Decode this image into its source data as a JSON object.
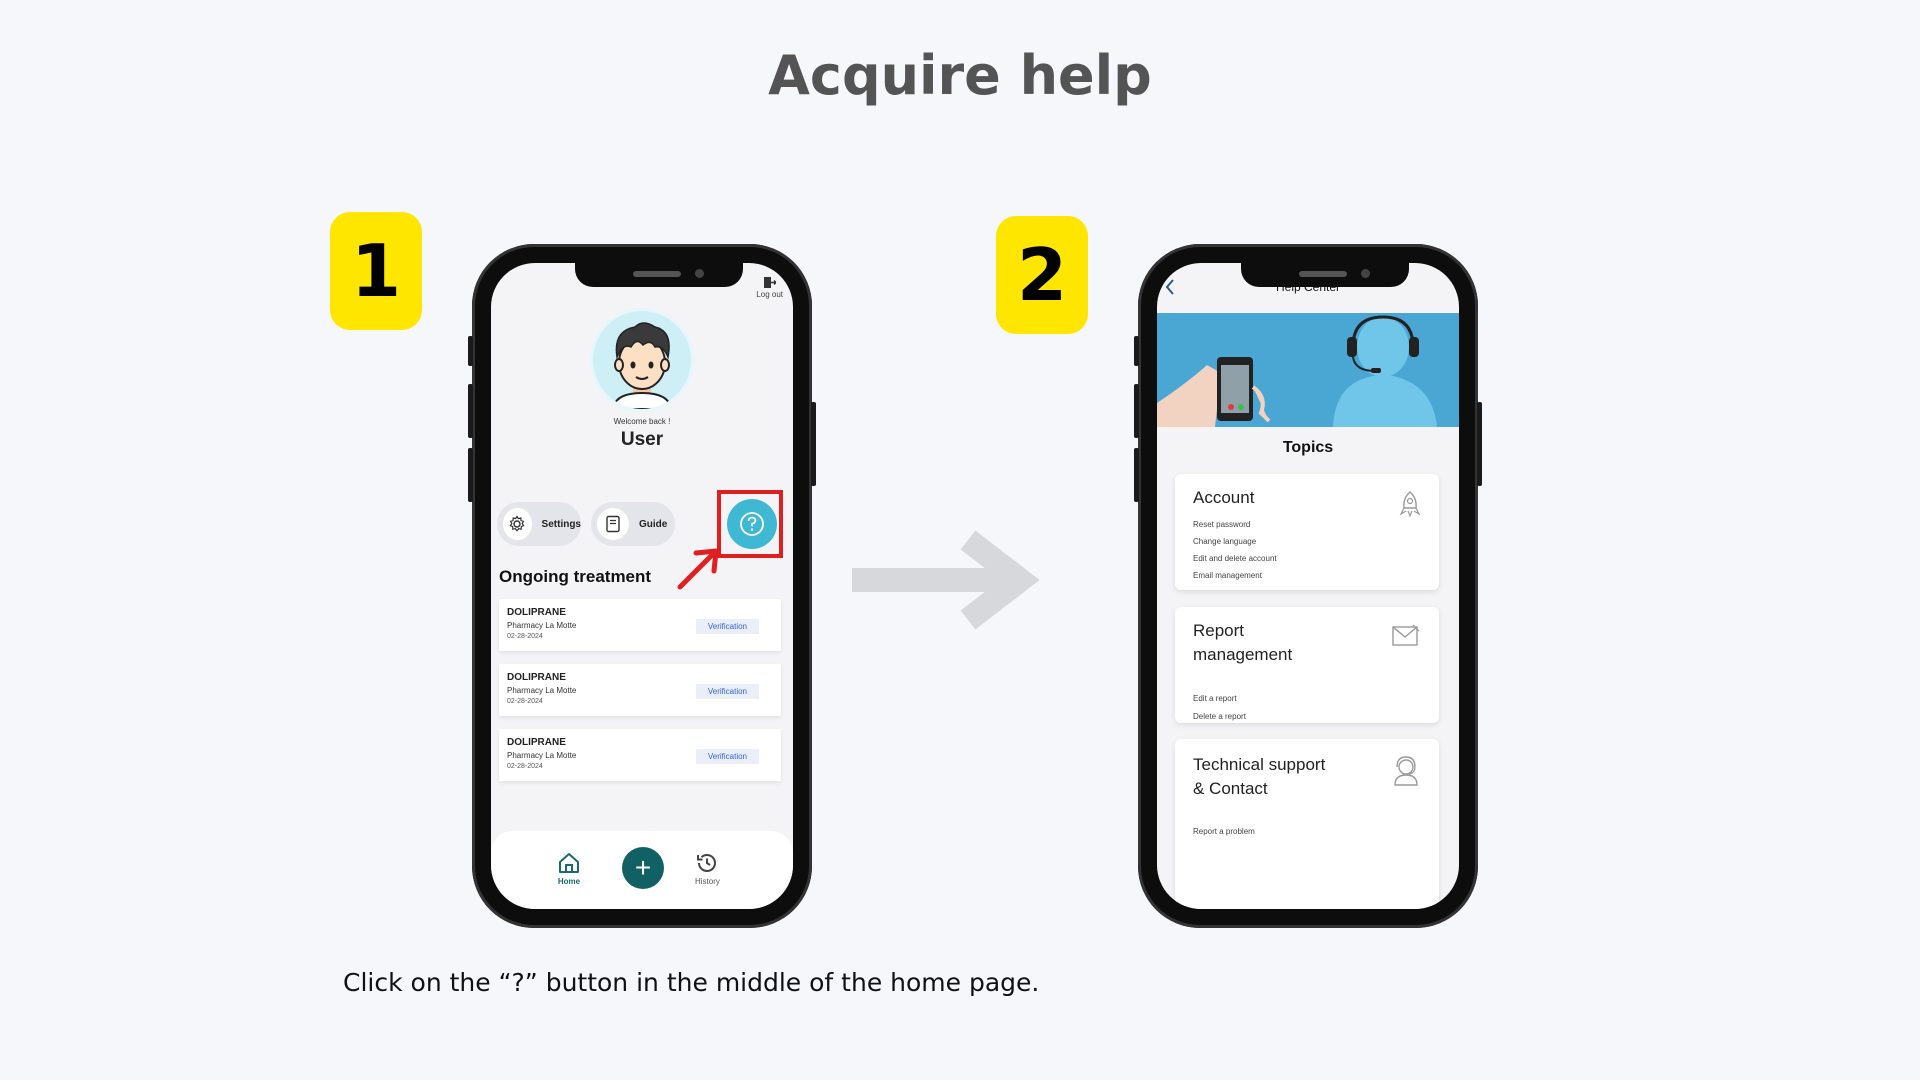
{
  "page": {
    "title": "Acquire help",
    "caption": "Click on the “?” button in the middle of the home page."
  },
  "steps": [
    "1",
    "2"
  ],
  "home_screen": {
    "logout_label": "Log out",
    "welcome": "Welcome back !",
    "username": "User",
    "buttons": {
      "settings": "Settings",
      "guide": "Guide",
      "help_icon": "question-circle-icon"
    },
    "section_title": "Ongoing treatment",
    "treatments": [
      {
        "drug": "DOLIPRANE",
        "pharmacy": "Pharmacy La Motte",
        "date": "02-28-2024",
        "status": "Verification"
      },
      {
        "drug": "DOLIPRANE",
        "pharmacy": "Pharmacy La Motte",
        "date": "02-28-2024",
        "status": "Verification"
      },
      {
        "drug": "DOLIPRANE",
        "pharmacy": "Pharmacy La Motte",
        "date": "02-28-2024",
        "status": "Verification"
      }
    ],
    "tabbar": {
      "home": "Home",
      "history": "History"
    }
  },
  "help_screen": {
    "title": "Help Center",
    "topics_heading": "Topics",
    "topics": [
      {
        "title": "Account",
        "items": [
          "Reset password",
          "Change language",
          "Edit and delete account",
          "Email management"
        ],
        "icon": "rocket-icon"
      },
      {
        "title_lines": [
          "Report",
          "management"
        ],
        "items": [
          "Edit a report",
          "Delete a report"
        ],
        "icon": "envelope-icon"
      },
      {
        "title_lines": [
          "Technical support",
          "& Contact"
        ],
        "items": [
          "Report a problem"
        ],
        "icon": "support-agent-icon"
      }
    ]
  },
  "colors": {
    "step_badge": "#ffe600",
    "help_button": "#3fb8d4",
    "highlight": "#e02020",
    "plus_button": "#116064",
    "banner": "#4aa7d4"
  }
}
